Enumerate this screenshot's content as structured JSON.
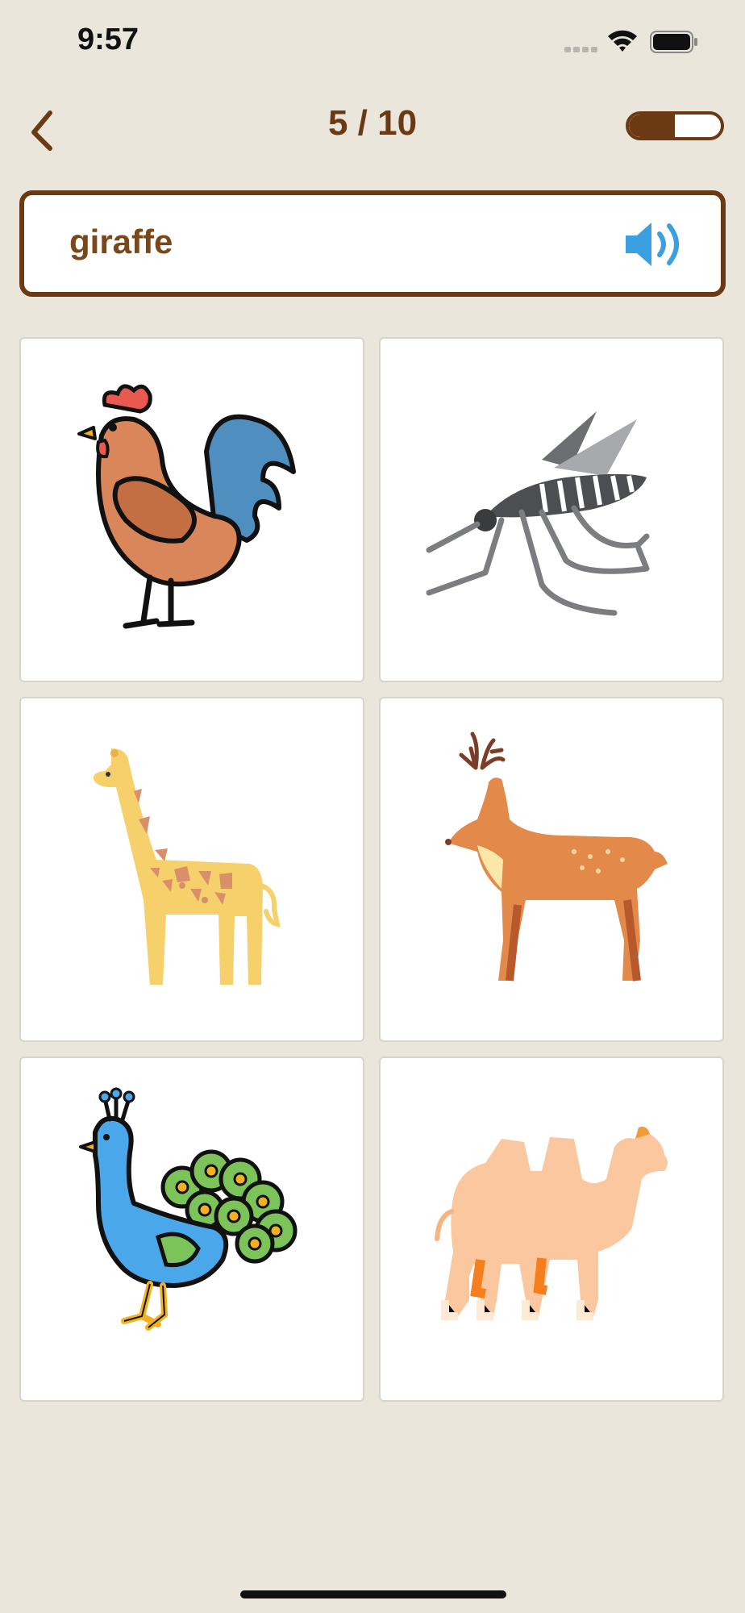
{
  "status_bar": {
    "time": "9:57"
  },
  "header": {
    "progress": "5 / 10",
    "progress_fraction": 0.5
  },
  "word_card": {
    "word": "giraffe"
  },
  "options": [
    {
      "animal": "rooster",
      "icon": "rooster-icon"
    },
    {
      "animal": "mosquito",
      "icon": "mosquito-icon"
    },
    {
      "animal": "giraffe",
      "icon": "giraffe-icon"
    },
    {
      "animal": "deer",
      "icon": "deer-icon"
    },
    {
      "animal": "peacock",
      "icon": "peacock-icon"
    },
    {
      "animal": "camel",
      "icon": "camel-icon"
    }
  ],
  "colors": {
    "accent": "#6b3a14",
    "background": "#ebe6dc",
    "speaker": "#3aa0e0"
  }
}
